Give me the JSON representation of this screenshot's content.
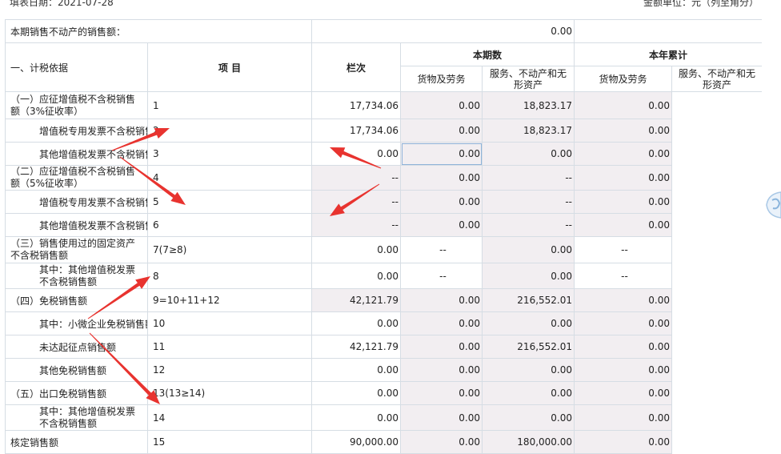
{
  "header": {
    "date_label": "填表日期：",
    "date_value": "2021-07-28",
    "unit_label": "金额单位：元（列至角分）"
  },
  "top_row": {
    "label": "本期销售不动产的销售额：",
    "value": "0.00"
  },
  "columns": {
    "item": "项 目",
    "col_no": "栏次",
    "current": "本期数",
    "ytd": "本年累计",
    "goods": "货物及劳务",
    "service": "服务、不动产和无形资产"
  },
  "section_label": "一、计税依据",
  "rows": [
    {
      "name": "（一）应征增值税不含税销售额（3%征收率）",
      "col": "1",
      "c_goods": "17,734.06",
      "c_serv": "0.00",
      "y_goods": "18,823.17",
      "y_serv": "0.00"
    },
    {
      "name": "增值税专用发票不含税销售额",
      "col": "2",
      "c_goods": "17,734.06",
      "c_serv": "0.00",
      "y_goods": "18,823.17",
      "y_serv": "0.00"
    },
    {
      "name": "其他增值税发票不含税销售额",
      "col": "3",
      "c_goods": "0.00",
      "c_serv": "0.00",
      "y_goods": "0.00",
      "y_serv": "0.00"
    },
    {
      "name": "（二）应征增值税不含税销售额（5%征收率）",
      "col": "4",
      "c_goods": "--",
      "c_serv": "0.00",
      "y_goods": "--",
      "y_serv": "0.00"
    },
    {
      "name": "增值税专用发票不含税销售额",
      "col": "5",
      "c_goods": "--",
      "c_serv": "0.00",
      "y_goods": "--",
      "y_serv": "0.00"
    },
    {
      "name": "其他增值税发票不含税销售额",
      "col": "6",
      "c_goods": "--",
      "c_serv": "0.00",
      "y_goods": "--",
      "y_serv": "0.00"
    },
    {
      "name": "（三）销售使用过的固定资产不含税销售额",
      "col": "7(7≥8)",
      "c_goods": "0.00",
      "c_serv": "--",
      "y_goods": "0.00",
      "y_serv": "--"
    },
    {
      "name": "其中：其他增值税发票不含税销售额",
      "col": "8",
      "c_goods": "0.00",
      "c_serv": "--",
      "y_goods": "0.00",
      "y_serv": "--"
    },
    {
      "name": "（四）免税销售额",
      "col": "9=10+11+12",
      "c_goods": "42,121.79",
      "c_serv": "0.00",
      "y_goods": "216,552.01",
      "y_serv": "0.00"
    },
    {
      "name": "其中：小微企业免税销售额",
      "col": "10",
      "c_goods": "0.00",
      "c_serv": "0.00",
      "y_goods": "0.00",
      "y_serv": "0.00"
    },
    {
      "name": "未达起征点销售额",
      "col": "11",
      "c_goods": "42,121.79",
      "c_serv": "0.00",
      "y_goods": "216,552.01",
      "y_serv": "0.00"
    },
    {
      "name": "其他免税销售额",
      "col": "12",
      "c_goods": "0.00",
      "c_serv": "0.00",
      "y_goods": "0.00",
      "y_serv": "0.00"
    },
    {
      "name": "（五）出口免税销售额",
      "col": "13(13≥14)",
      "c_goods": "0.00",
      "c_serv": "0.00",
      "y_goods": "0.00",
      "y_serv": "0.00"
    },
    {
      "name": "其中：其他增值税发票不含税销售额",
      "col": "14",
      "c_goods": "0.00",
      "c_serv": "0.00",
      "y_goods": "0.00",
      "y_serv": "0.00"
    },
    {
      "name": "核定销售额",
      "col": "15",
      "c_goods": "90,000.00",
      "c_serv": "0.00",
      "y_goods": "180,000.00",
      "y_serv": "0.00"
    }
  ],
  "annotation_color": "#e8332f"
}
